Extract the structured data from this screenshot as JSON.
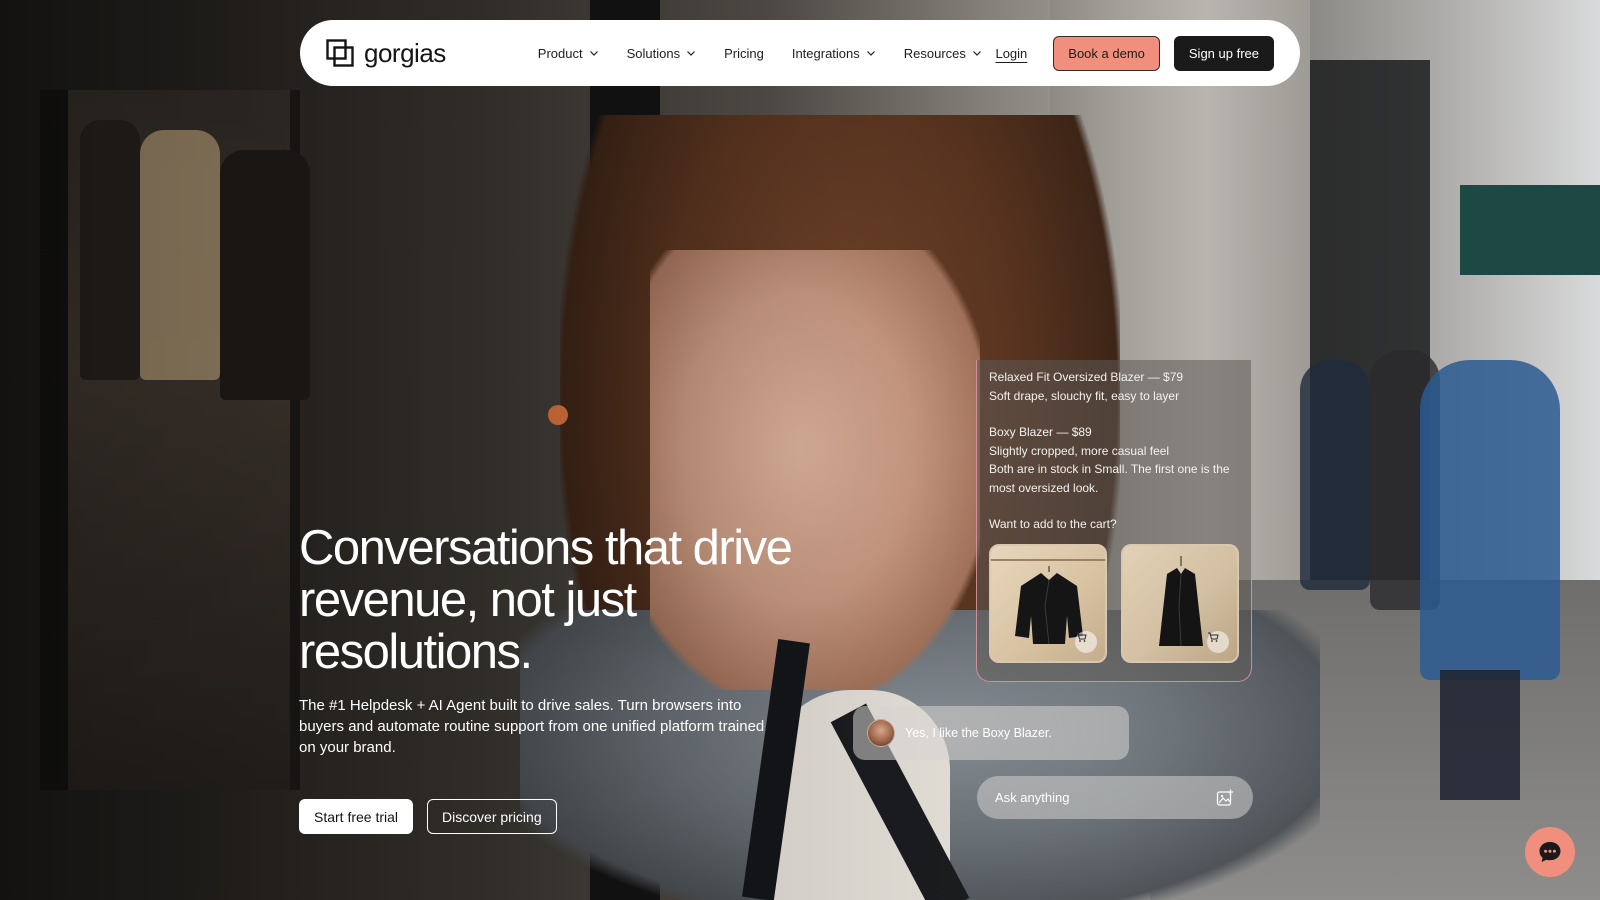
{
  "brand": {
    "name": "gorgias"
  },
  "nav": {
    "items": [
      {
        "label": "Product",
        "dropdown": true
      },
      {
        "label": "Solutions",
        "dropdown": true
      },
      {
        "label": "Pricing",
        "dropdown": false
      },
      {
        "label": "Integrations",
        "dropdown": true
      },
      {
        "label": "Resources",
        "dropdown": true
      }
    ],
    "login": "Login",
    "book_demo": "Book a demo",
    "sign_up": "Sign up free"
  },
  "hero": {
    "title": "Conversations that drive revenue, not just resolutions.",
    "subtitle": "The #1 Helpdesk + AI Agent built to drive sales. Turn browsers into buyers and automate routine support from one unified platform trained on your brand.",
    "cta_primary": "Start free trial",
    "cta_secondary": "Discover pricing"
  },
  "chat": {
    "product1_title": "Relaxed Fit Oversized Blazer — $79",
    "product1_desc": "Soft drape, slouchy fit, easy to layer",
    "product2_title": "Boxy Blazer — $89",
    "product2_desc": "Slightly cropped, more casual feel",
    "stock_note": "Both are in stock in Small. The first one is the most oversized look.",
    "question": "Want to add to the cart?",
    "user_message": "Yes, I like the Boxy Blazer.",
    "input_placeholder": "Ask anything"
  },
  "colors": {
    "accent": "#f08f7d",
    "dark_button": "#1a1a1a",
    "card_border": "#f0a0aa"
  },
  "icons": {
    "logo": "gorgias-logo-icon",
    "dropdown": "chevron-down-icon",
    "cart": "cart-icon",
    "image_upload": "image-add-icon",
    "chat_launcher": "chat-bubble-icon"
  }
}
